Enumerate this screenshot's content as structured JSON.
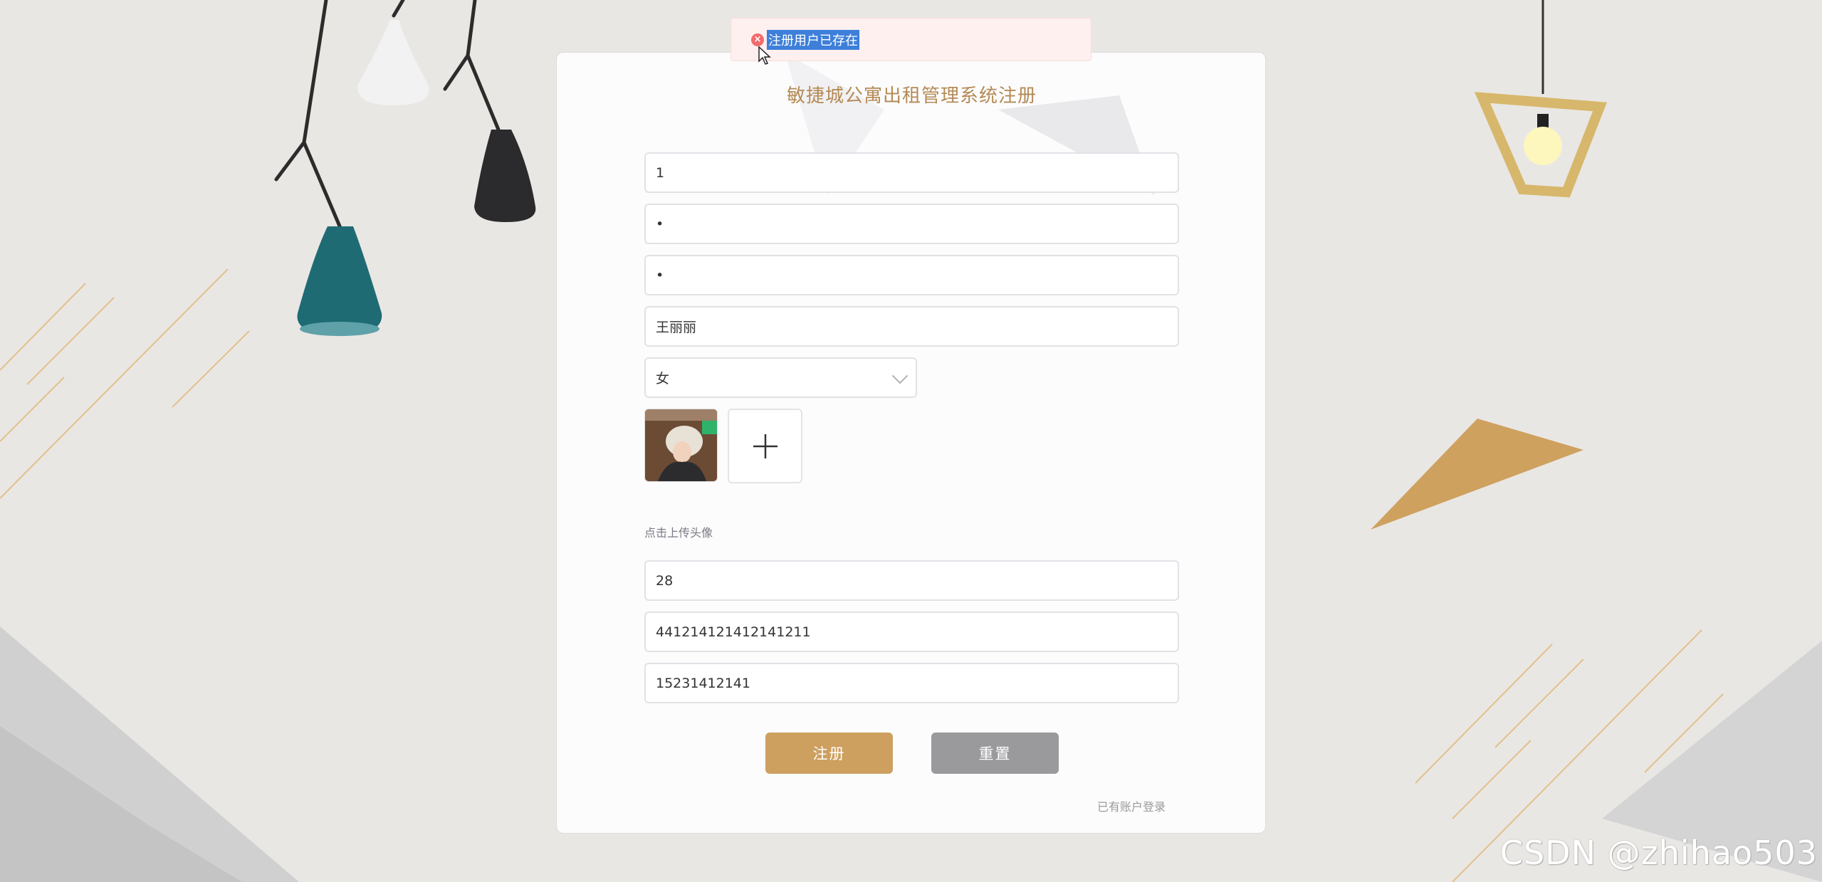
{
  "page": {
    "title": "敏捷城公寓出租管理系统注册"
  },
  "toast": {
    "message": "注册用户已存在",
    "icon": "error-circle-icon",
    "color": "#f36b6b"
  },
  "form": {
    "account": {
      "value": "1"
    },
    "password": {
      "value": "•"
    },
    "confirm_password": {
      "value": "•"
    },
    "name": {
      "value": "王丽丽"
    },
    "gender": {
      "value": "女",
      "icon": "chevron-down-icon"
    },
    "avatar": {
      "upload_icon": "plus-icon",
      "hint": "点击上传头像"
    },
    "age": {
      "value": "28"
    },
    "id_card": {
      "value": "441214121412141211"
    },
    "phone": {
      "value": "15231412141"
    }
  },
  "buttons": {
    "register_label": "注册",
    "reset_label": "重置"
  },
  "links": {
    "login": "已有账户登录"
  },
  "watermark": "CSDN @zhihao503",
  "colors": {
    "accent": "#cda060",
    "title": "#b48a55",
    "reset": "#9a9a9c",
    "error": "#f36b6b"
  }
}
